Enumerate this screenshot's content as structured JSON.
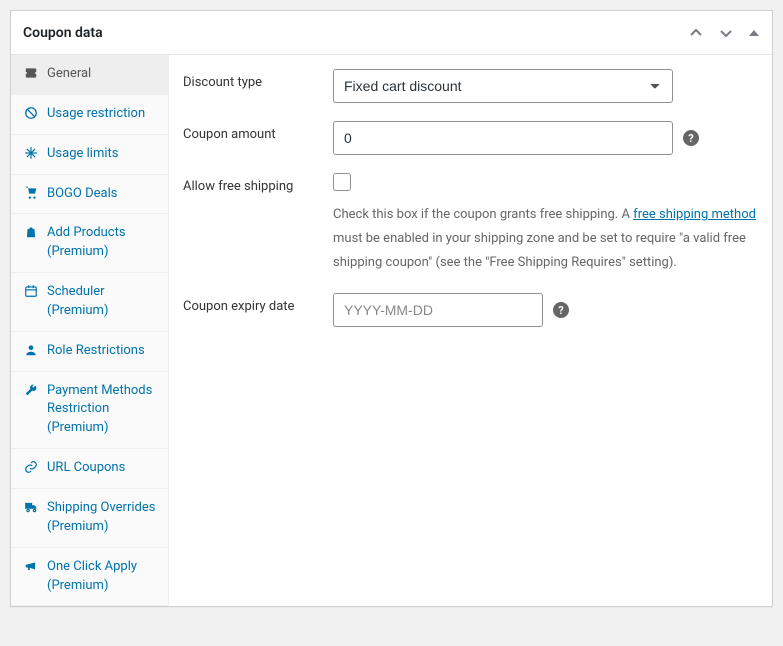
{
  "panel": {
    "title": "Coupon data"
  },
  "tabs": [
    {
      "label": "General",
      "icon": "ticket",
      "active": true
    },
    {
      "label": "Usage restriction",
      "icon": "ban",
      "active": false
    },
    {
      "label": "Usage limits",
      "icon": "expand",
      "active": false
    },
    {
      "label": "BOGO Deals",
      "icon": "cart",
      "active": false
    },
    {
      "label": "Add Products (Premium)",
      "icon": "bag",
      "active": false
    },
    {
      "label": "Scheduler (Premium)",
      "icon": "calendar",
      "active": false
    },
    {
      "label": "Role Restrictions",
      "icon": "user",
      "active": false
    },
    {
      "label": "Payment Methods Restriction (Premium)",
      "icon": "wrench",
      "active": false
    },
    {
      "label": "URL Coupons",
      "icon": "link",
      "active": false
    },
    {
      "label": "Shipping Overrides (Premium)",
      "icon": "truck",
      "active": false
    },
    {
      "label": "One Click Apply (Premium)",
      "icon": "megaphone",
      "active": false
    }
  ],
  "fields": {
    "discount_type": {
      "label": "Discount type",
      "value": "Fixed cart discount"
    },
    "coupon_amount": {
      "label": "Coupon amount",
      "value": "0"
    },
    "free_shipping": {
      "label": "Allow free shipping",
      "checked": false,
      "desc_before_link": "Check this box if the coupon grants free shipping. A ",
      "link_text": "free shipping method",
      "desc_after_link": " must be enabled in your shipping zone and be set to require \"a valid free shipping coupon\" (see the \"Free Shipping Requires\" setting)."
    },
    "expiry": {
      "label": "Coupon expiry date",
      "placeholder": "YYYY-MM-DD"
    }
  }
}
